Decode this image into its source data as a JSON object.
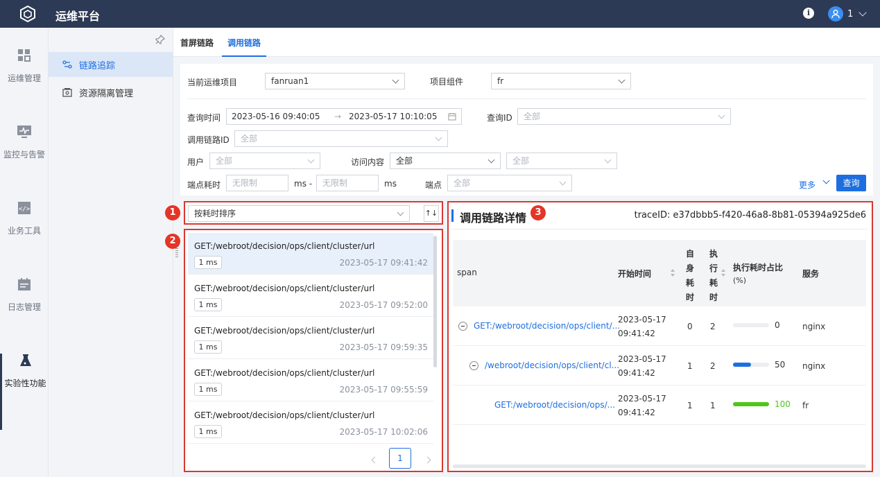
{
  "app": {
    "title": "运维平台",
    "user": "1"
  },
  "rail": {
    "items": [
      {
        "label": "运维管理",
        "icon": "grid-icon"
      },
      {
        "label": "监控与告警",
        "icon": "monitor-icon"
      },
      {
        "label": "业务工具",
        "icon": "code-icon"
      },
      {
        "label": "日志管理",
        "icon": "calendar-icon"
      },
      {
        "label": "实验性功能",
        "icon": "flask-icon"
      }
    ]
  },
  "submenu": {
    "items": [
      {
        "label": "链路追踪",
        "icon": "trace-icon"
      },
      {
        "label": "资源隔离管理",
        "icon": "isolation-icon"
      }
    ]
  },
  "tabs": [
    {
      "label": "首屏链路"
    },
    {
      "label": "调用链路"
    }
  ],
  "filter": {
    "project_label": "当前运维项目",
    "project_value": "fanruan1",
    "component_label": "项目组件",
    "component_value": "fr",
    "time_label": "查询时间",
    "time_start": "2023-05-16 09:40:05",
    "time_end": "2023-05-17 10:10:05",
    "query_id_label": "查询ID",
    "query_id_placeholder": "全部",
    "chain_id_label": "调用链路ID",
    "chain_id_placeholder": "全部",
    "user_label": "用户",
    "user_placeholder": "全部",
    "access_label": "访问内容",
    "access_value": "全部",
    "access2_placeholder": "全部",
    "endpoint_time_label": "端点耗时",
    "min_placeholder": "无限制",
    "ms_dash": "ms -",
    "max_placeholder": "无限制",
    "ms": "ms",
    "endpoint_label": "端点",
    "endpoint_placeholder": "全部",
    "more": "更多",
    "query_button": "查询"
  },
  "sort": {
    "value": "按耗时排序",
    "toggle": "↑↓"
  },
  "trace_list": [
    {
      "path": "GET:/webroot/decision/ops/client/cluster/url",
      "ms": "1 ms",
      "time": "2023-05-17 09:41:42",
      "selected": true
    },
    {
      "path": "GET:/webroot/decision/ops/client/cluster/url",
      "ms": "1 ms",
      "time": "2023-05-17 09:52:00"
    },
    {
      "path": "GET:/webroot/decision/ops/client/cluster/url",
      "ms": "1 ms",
      "time": "2023-05-17 09:59:35"
    },
    {
      "path": "GET:/webroot/decision/ops/client/cluster/url",
      "ms": "1 ms",
      "time": "2023-05-17 09:55:59"
    },
    {
      "path": "GET:/webroot/decision/ops/client/cluster/url",
      "ms": "1 ms",
      "time": "2023-05-17 10:02:06"
    }
  ],
  "pagination": {
    "page": "1"
  },
  "badges": [
    "1",
    "2",
    "3"
  ],
  "detail": {
    "title": "调用链路详情",
    "trace_id": "traceID: e37dbbb5-f420-46a8-8b81-05394a925de6",
    "columns": {
      "span": "span",
      "start": "开始时间",
      "self": "自身耗时",
      "exec": "执行耗时",
      "ratio": "执行耗时占比",
      "ratio_unit": "(%)",
      "service": "服务"
    },
    "rows": [
      {
        "span": "GET:/webroot/decision/ops/client/...",
        "date": "2023-05-17",
        "time": "09:41:42",
        "self": "0",
        "exec": "2",
        "ratio": 0,
        "ratio_label": "0",
        "service": "nginx",
        "color": "#e8eaee"
      },
      {
        "span": "/webroot/decision/ops/client/cl...",
        "date": "2023-05-17",
        "time": "09:41:42",
        "self": "1",
        "exec": "2",
        "ratio": 50,
        "ratio_label": "50",
        "service": "nginx",
        "color": "#1d6fe0"
      },
      {
        "span": "GET:/webroot/decision/ops/...",
        "date": "2023-05-17",
        "time": "09:41:42",
        "self": "1",
        "exec": "1",
        "ratio": 100,
        "ratio_label": "100",
        "service": "fr",
        "color": "#52c41a"
      }
    ]
  }
}
